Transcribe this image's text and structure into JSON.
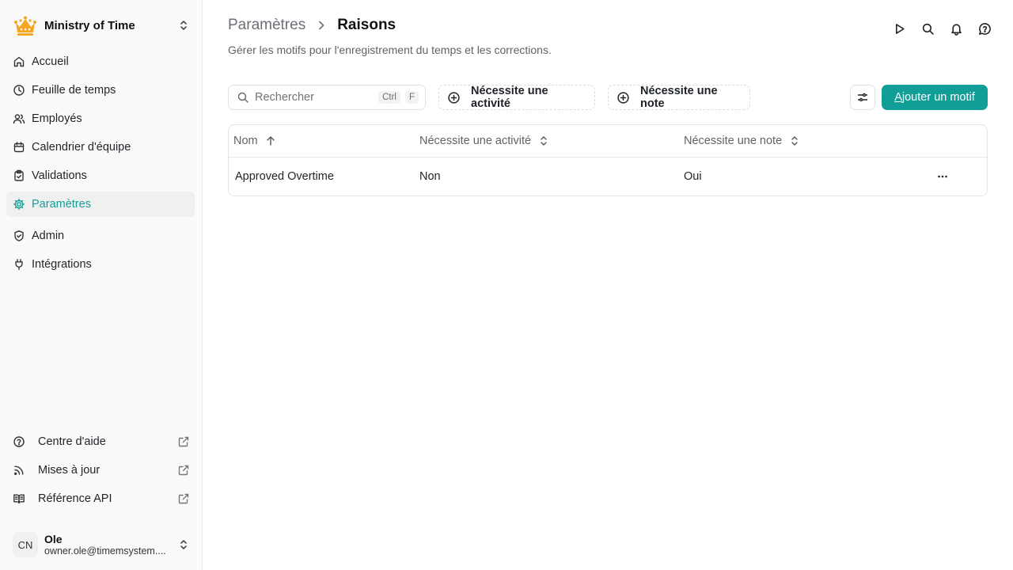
{
  "app": {
    "name": "Ministry of Time",
    "brand_color": "#f5a623",
    "accent_color": "#0f9f95"
  },
  "sidebar": {
    "items": [
      {
        "label": "Accueil",
        "icon": "home-icon"
      },
      {
        "label": "Feuille de temps",
        "icon": "clock-icon"
      },
      {
        "label": "Employés",
        "icon": "users-icon"
      },
      {
        "label": "Calendrier d'équipe",
        "icon": "calendar-icon"
      },
      {
        "label": "Validations",
        "icon": "clipboard-check-icon"
      },
      {
        "label": "Paramètres",
        "icon": "gear-icon",
        "active": true
      },
      {
        "label": "Admin",
        "icon": "shield-check-icon"
      },
      {
        "label": "Intégrations",
        "icon": "plug-icon"
      }
    ],
    "footer_links": [
      {
        "label": "Centre d'aide",
        "icon": "help-circle-icon"
      },
      {
        "label": "Mises à jour",
        "icon": "rss-icon"
      },
      {
        "label": "Référence API",
        "icon": "book-icon"
      }
    ],
    "user": {
      "initials": "CN",
      "name": "Ole",
      "email": "owner.ole@timemsystem...."
    }
  },
  "header": {
    "breadcrumb_parent": "Paramètres",
    "breadcrumb_current": "Raisons",
    "subtitle": "Gérer les motifs pour l'enregistrement du temps et les corrections."
  },
  "toolbar": {
    "search_placeholder": "Rechercher",
    "kbd_ctrl": "Ctrl",
    "kbd_f": "F",
    "filter_activity": "Nécessite une activité",
    "filter_note": "Nécessite une note",
    "add_first_letter": "A",
    "add_rest": "jouter un motif"
  },
  "table": {
    "columns": [
      "Nom",
      "Nécessite une activité",
      "Nécessite une note"
    ],
    "rows": [
      [
        "Approved Overtime",
        "Non",
        "Oui"
      ]
    ]
  }
}
